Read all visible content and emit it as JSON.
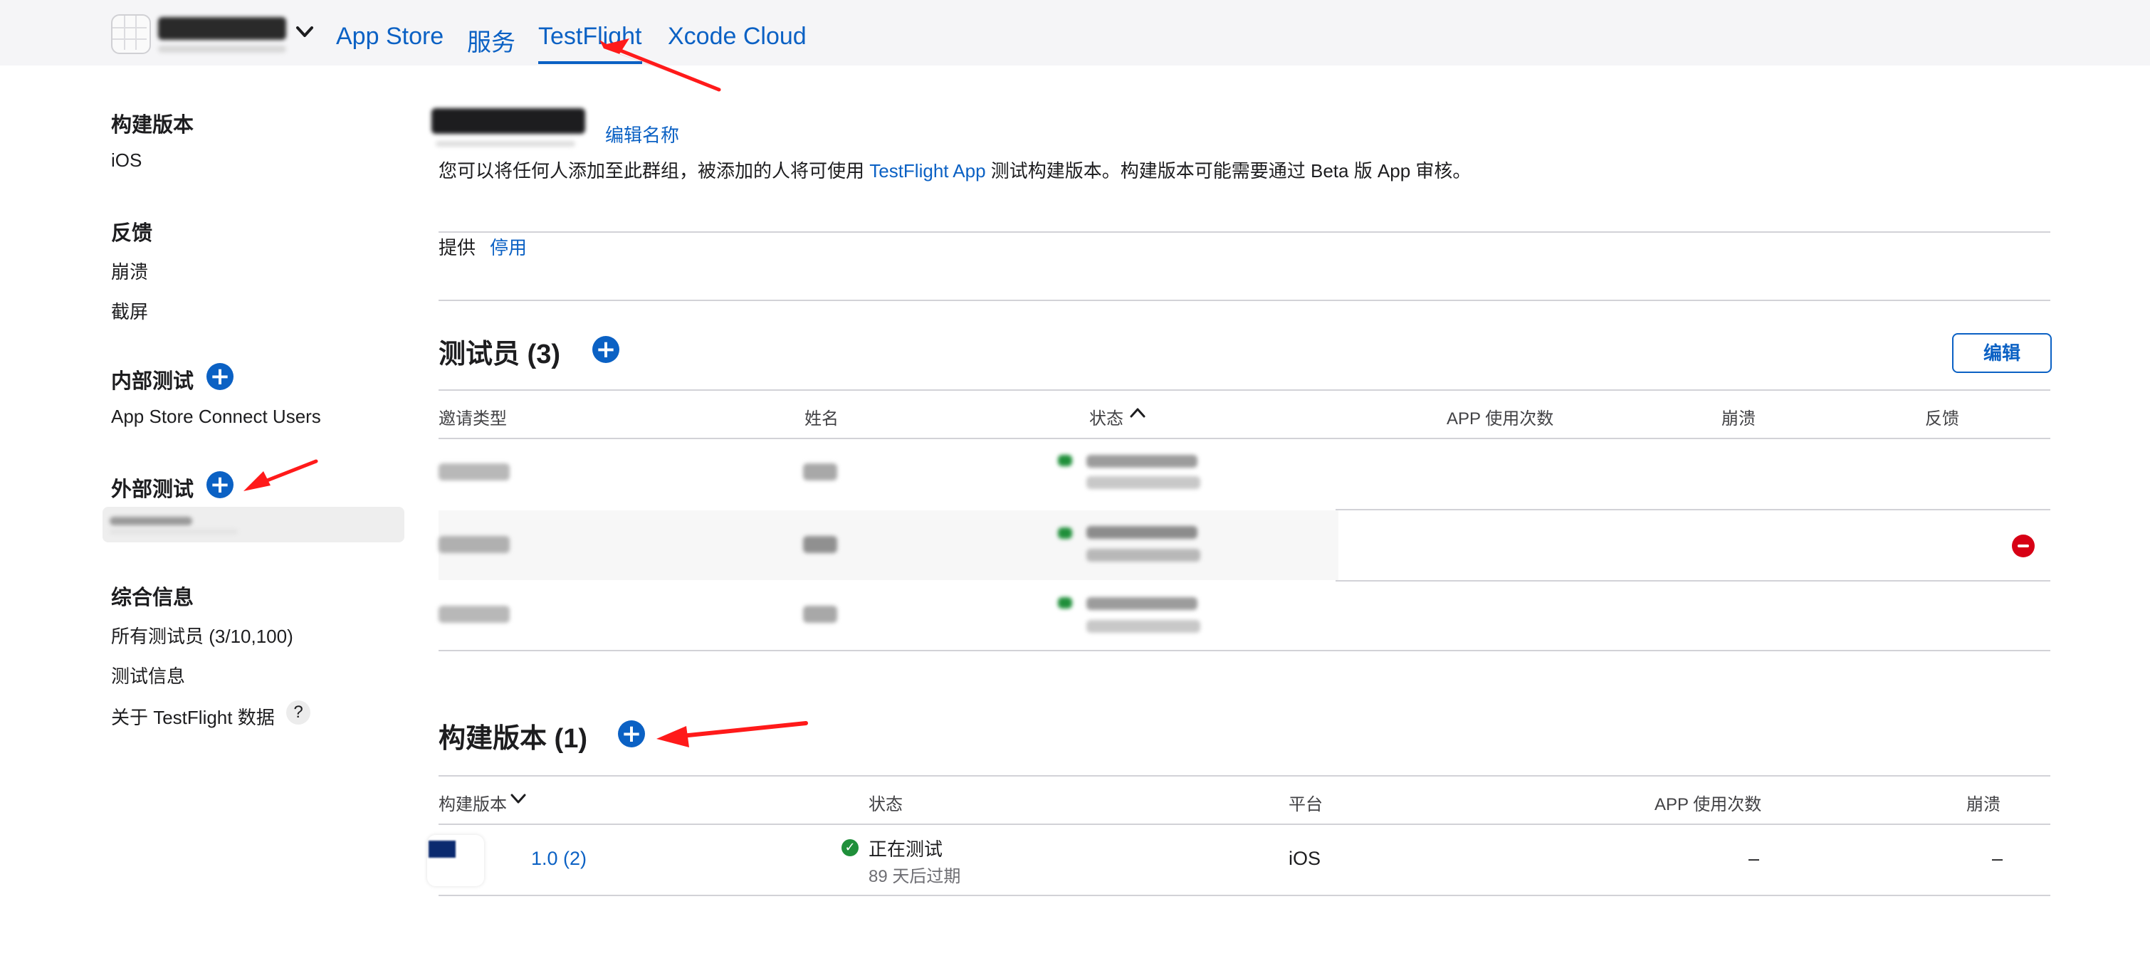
{
  "header": {
    "app_name_hidden": "",
    "tabs": [
      "App Store",
      "服务",
      "TestFlight",
      "Xcode Cloud"
    ],
    "active_tab": "TestFlight",
    "chevron": "chevron-down-icon"
  },
  "sidebar": {
    "builds_heading": "构建版本",
    "builds_ios": "iOS",
    "feedback_heading": "反馈",
    "feedback_crashes": "崩溃",
    "feedback_screenshots": "截屏",
    "internal_heading": "内部测试",
    "internal_item": "App Store Connect Users",
    "external_heading": "外部测试",
    "info_heading": "综合信息",
    "all_testers": "所有测试员 (3/10,100)",
    "test_info": "测试信息",
    "about_data": "关于 TestFlight 数据",
    "help": "?"
  },
  "group": {
    "edit_name": "编辑名称",
    "desc_before": "您可以将任何人添加至此群组，被添加的人将可使用 ",
    "desc_link": "TestFlight App",
    "desc_after": " 测试构建版本。构建版本可能需要通过 Beta 版 App 审核。",
    "provide_label": "提供",
    "disable_link": "停用"
  },
  "testers": {
    "heading": "测试员 (3)",
    "edit_button": "编辑",
    "columns": [
      "邀请类型",
      "姓名",
      "状态",
      "APP 使用次数",
      "崩溃",
      "反馈"
    ],
    "sort_icon": "chevron-up-icon"
  },
  "builds": {
    "heading": "构建版本 (1)",
    "columns": [
      "构建版本",
      "状态",
      "平台",
      "APP 使用次数",
      "崩溃"
    ],
    "sort_icon": "chevron-down-icon",
    "rows": [
      {
        "version": "1.0 (2)",
        "status": "正在测试",
        "expires": "89 天后过期",
        "platform": "iOS",
        "uses": "–",
        "crashes": "–"
      }
    ]
  },
  "colors": {
    "accent": "#0b61c4",
    "annotation": "#ff1a1a",
    "remove": "#d70015",
    "ok": "#1f8f3a"
  }
}
